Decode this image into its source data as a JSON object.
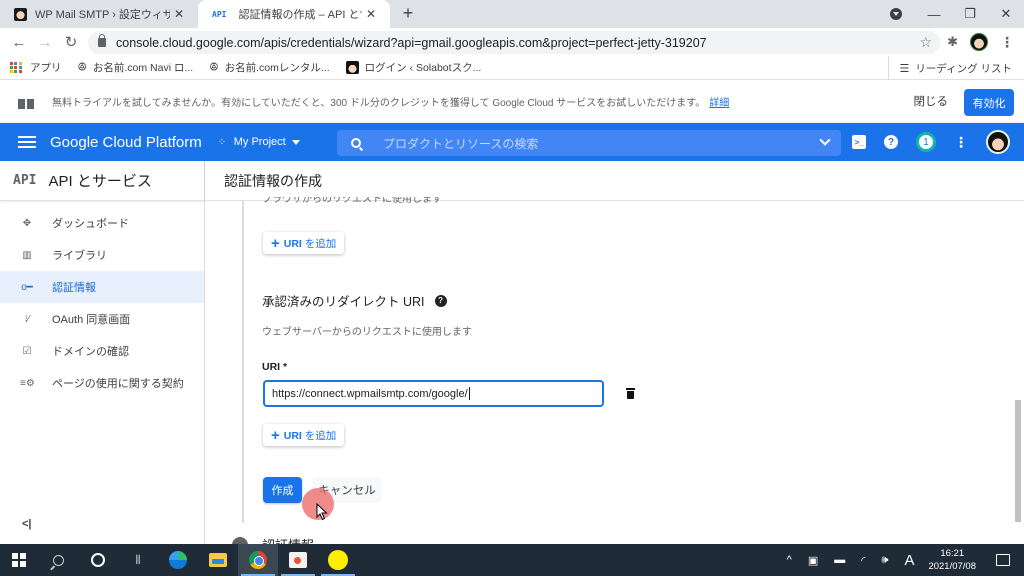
{
  "browser": {
    "tabs": [
      {
        "title": "WP Mail SMTP › 設定ウィザード",
        "active": false,
        "favicon": "avatar-favicon"
      },
      {
        "title": "認証情報の作成 – API とサービス – ",
        "favicon_text": "API",
        "active": true
      }
    ],
    "url": "console.cloud.google.com/apis/credentials/wizard?api=gmail.googleapis.com&project=perfect-jetty-319207",
    "bookmarks": [
      {
        "label": "アプリ",
        "icon": "apps-grid-icon"
      },
      {
        "label": "お名前.com Navi ロ...",
        "icon": "onamae-icon"
      },
      {
        "label": "お名前.comレンタル...",
        "icon": "onamae-icon"
      },
      {
        "label": "ログイン ‹ Solabotスク...",
        "icon": "avatar-favicon"
      }
    ],
    "reading_list": "リーディング リスト"
  },
  "banner": {
    "message": "無料トライアルを試してみませんか。有効にしていただくと、300 ドル分のクレジットを獲得して Google Cloud サービスをお試しいただけます。",
    "link": "詳細",
    "close": "閉じる",
    "enable": "有効化"
  },
  "gcp": {
    "title": "Google Cloud Platform",
    "project": "My Project",
    "search_placeholder": "プロダクトとリソースの検索",
    "notification_count": "1"
  },
  "sidebar": {
    "logo": "API",
    "title": "API とサービス",
    "items": [
      {
        "label": "ダッシュボード",
        "icon": "dashboard-icon",
        "active": false
      },
      {
        "label": "ライブラリ",
        "icon": "library-icon",
        "active": false
      },
      {
        "label": "認証情報",
        "icon": "key-icon",
        "active": true
      },
      {
        "label": "OAuth 同意画面",
        "icon": "consent-icon",
        "active": false
      },
      {
        "label": "ドメインの確認",
        "icon": "checkbox-icon",
        "active": false
      },
      {
        "label": "ページの使用に関する契約",
        "icon": "settings-list-icon",
        "active": false
      }
    ],
    "collapse": "<|"
  },
  "main": {
    "page_title": "認証情報の作成",
    "js_origins_desc": "ブラウザからのリクエストに使用します",
    "add_uri_label": "URI を追加",
    "add_uri_prefix": "URI",
    "add_uri_suffix": "を追加",
    "redirect_title": "承認済みのリダイレクト URI",
    "redirect_desc": "ウェブサーバーからのリクエストに使用します",
    "uri_field_label": "URI *",
    "uri_value": "https://connect.wpmailsmtp.com/google/",
    "create": "作成",
    "cancel": "キャンセル",
    "next_section": "認証情報"
  },
  "taskbar": {
    "time": "16:21",
    "date": "2021/07/08",
    "ime": "A"
  }
}
